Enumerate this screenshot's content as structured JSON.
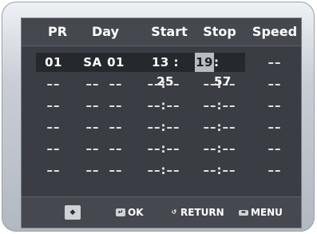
{
  "columns": [
    "PR",
    "Day",
    "Start",
    "Stop",
    "Speed"
  ],
  "selected_row": {
    "pr": "01",
    "day": "SA",
    "date": "01",
    "start": "13 : 25",
    "stop_hour": "19",
    "stop_rest": ": 57",
    "speed": "––"
  },
  "empty_row": {
    "pr": "––",
    "day": "––",
    "date": "––",
    "start": "––:––",
    "stop": "––:––",
    "speed": "––"
  },
  "footer": {
    "ok_label": "OK",
    "return_label": "RETURN",
    "menu_label": "MENU"
  },
  "colors": {
    "screen_bg": "#3a3d43",
    "highlight": "#b7bcc3",
    "text": "#ffffff"
  }
}
